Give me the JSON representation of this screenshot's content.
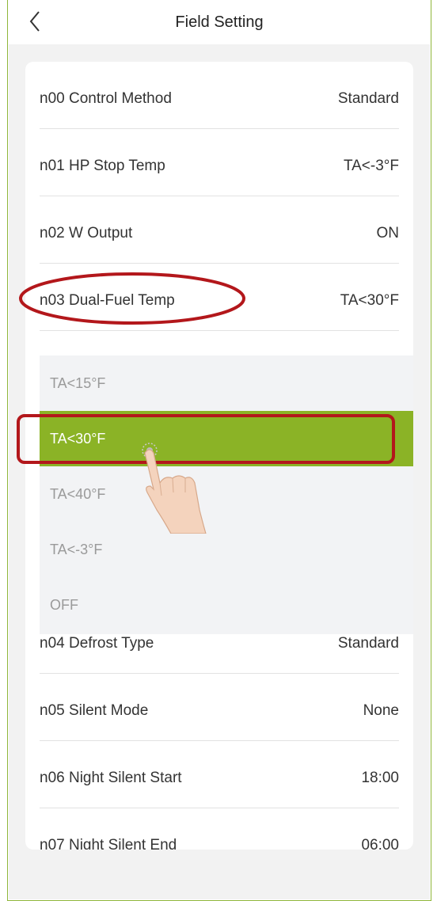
{
  "header": {
    "title": "Field Setting",
    "back_icon": "chevron-left-icon"
  },
  "settings": [
    {
      "label": "n00 Control Method",
      "value": "Standard"
    },
    {
      "label": "n01 HP Stop Temp",
      "value": "TA<-3°F"
    },
    {
      "label": "n02 W Output",
      "value": "ON"
    },
    {
      "label": "n03 Dual-Fuel Temp",
      "value": "TA<30°F"
    },
    {
      "label": "n04 Defrost Type",
      "value": "Standard"
    },
    {
      "label": "n05 Silent Mode",
      "value": "None"
    },
    {
      "label": "n06 Night Silent Start",
      "value": "18:00"
    },
    {
      "label": "n07 Night Silent End",
      "value": "06:00"
    }
  ],
  "picker": {
    "options": [
      "TA<15°F",
      "TA<30°F",
      "TA<40°F",
      "TA<-3°F",
      "OFF"
    ],
    "selected": "TA<30°F"
  },
  "colors": {
    "accent_green": "#8bb326",
    "highlight_red": "#b3171b",
    "frame_green": "#8fb63a"
  }
}
